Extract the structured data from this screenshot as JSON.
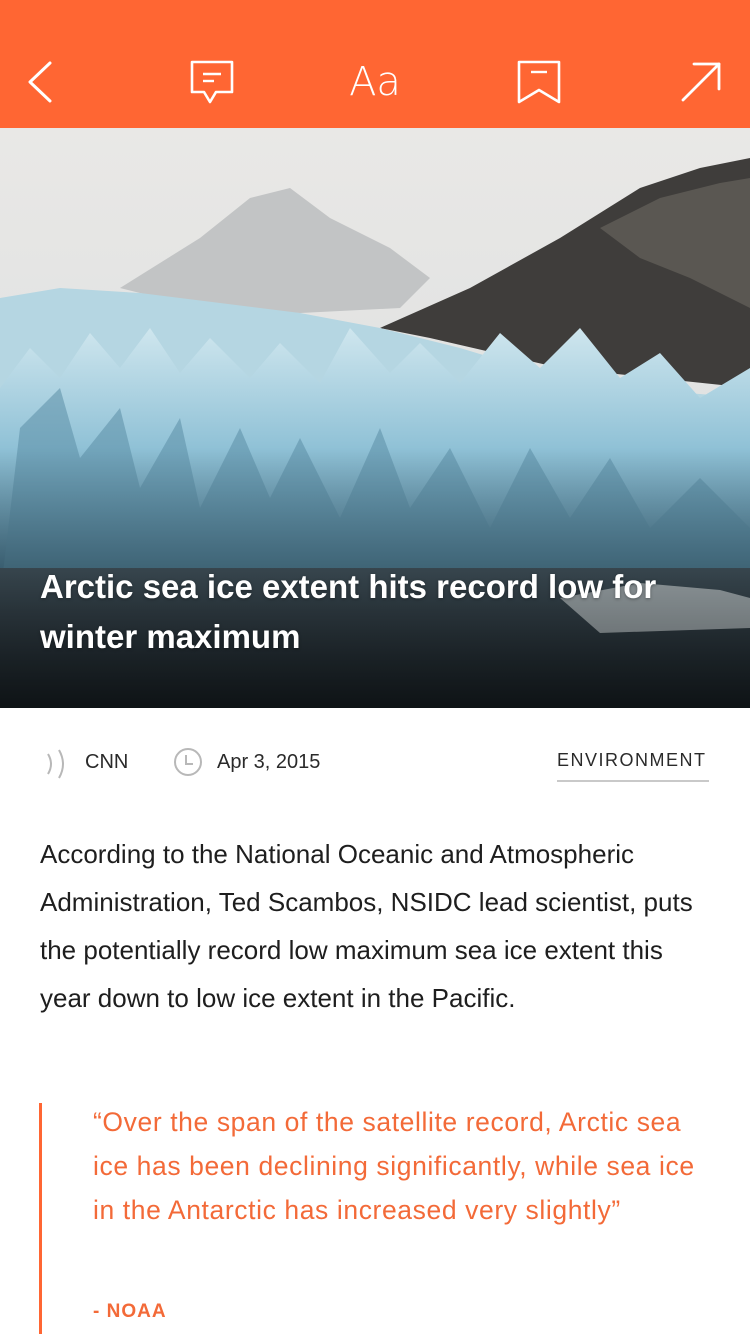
{
  "colors": {
    "accent": "#FF6633",
    "quote": "#F36A38",
    "text": "#1e1e1e"
  },
  "toolbar": {
    "back_icon": "chevron-left-icon",
    "comment_icon": "comment-icon",
    "font_label": "Aa",
    "bookmark_icon": "bookmark-icon",
    "share_icon": "arrow-up-right-icon"
  },
  "article": {
    "title": "Arctic sea ice extent hits record low for winter maximum",
    "source": "CNN",
    "date": "Apr 3, 2015",
    "category": "ENVIRONMENT",
    "body": "According to the National Oceanic and Atmospheric Administration, Ted Scambos, NSIDC lead scientist, puts the potentially record low maximum sea ice extent this year down to low ice extent in the Pacific.",
    "quote": "“Over the span of the satellite record, Arctic sea ice has been declining significantly, while sea ice in the Antarctic has increased very slightly”",
    "quote_source": "- NOAA"
  }
}
